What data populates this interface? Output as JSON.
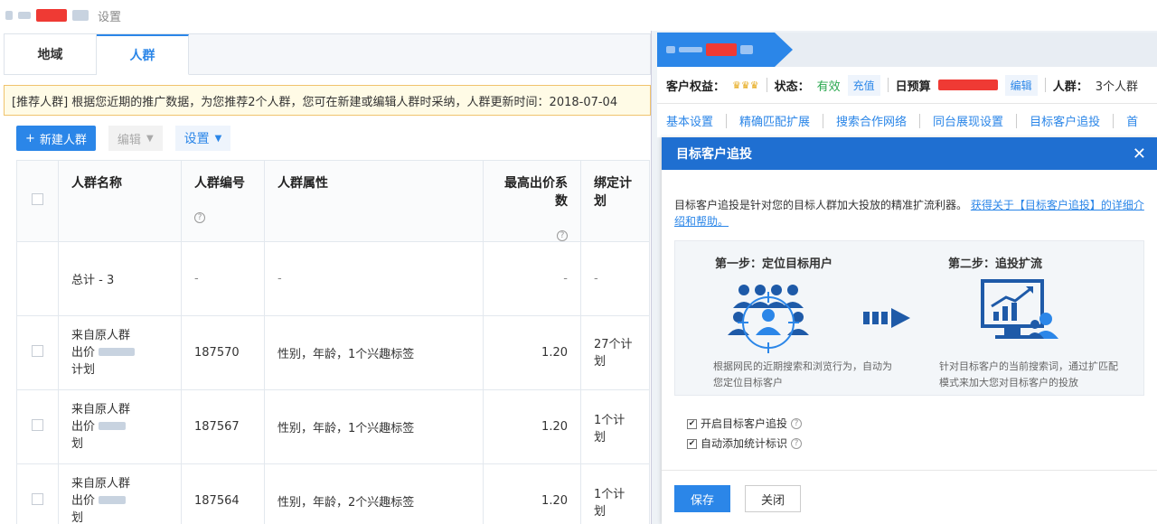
{
  "breadcrumb": {
    "current": "设置"
  },
  "tabs": [
    {
      "label": "地域"
    },
    {
      "label": "人群"
    }
  ],
  "notice": "[推荐人群] 根据您近期的推广数据，为您推荐2个人群，您可在新建或编辑人群时采纳，人群更新时间：2018-07-04",
  "toolbar": {
    "new_label": "新建人群",
    "edit_label": "编辑",
    "settings_label": "设置"
  },
  "table": {
    "headers": {
      "name": "人群名称",
      "id": "人群编号",
      "attr": "人群属性",
      "coef": "最高出价系数",
      "plan": "绑定计划"
    },
    "total": {
      "name": "总计 - 3",
      "id": "-",
      "attr": "-",
      "coef": "-",
      "plan": "-"
    },
    "rows": [
      {
        "name_line1": "来自原人群",
        "name_line2": "出价",
        "name_line3": "计划",
        "id": "187570",
        "attr": "性别，年龄，1个兴趣标签",
        "coef": "1.20",
        "plan": "27个计划"
      },
      {
        "name_line1": "来自原人群",
        "name_line2": "出价",
        "name_line3": "划",
        "id": "187567",
        "attr": "性别，年龄，1个兴趣标签",
        "coef": "1.20",
        "plan": "1个计划"
      },
      {
        "name_line1": "来自原人群",
        "name_line2": "出价",
        "name_line3": "划",
        "id": "187564",
        "attr": "性别，年龄，2个兴趣标签",
        "coef": "1.20",
        "plan": "1个计划"
      }
    ]
  },
  "account": {
    "rights_label": "客户权益：",
    "status_label": "状态：",
    "status_value": "有效",
    "recharge": "充值",
    "budget_label": "日预算",
    "edit": "编辑",
    "crowd_label": "人群：",
    "crowd_value": "3个人群"
  },
  "subnav": [
    "基本设置",
    "精确匹配扩展",
    "搜索合作网络",
    "同台展现设置",
    "目标客户追投",
    "首"
  ],
  "dialog": {
    "title": "目标客户追投",
    "desc": "目标客户追投是针对您的目标人群加大投放的精准扩流利器。",
    "desc_link": "获得关于【目标客户追投】的详细介绍和帮助。",
    "step1_title": "第一步：定位目标用户",
    "step1_text": "根据网民的近期搜索和浏览行为，自动为您定位目标客户",
    "step2_title": "第二步：追投扩流",
    "step2_text": "针对目标客户的当前搜索词，通过扩匹配模式来加大您对目标客户的投放",
    "opt1": "开启目标客户追投",
    "opt2": "自动添加统计标识",
    "save": "保存",
    "close": "关闭"
  },
  "colors": {
    "primary": "#2b86e8",
    "dialog_header": "#1f6fd1",
    "status_green": "#2aa84f"
  }
}
